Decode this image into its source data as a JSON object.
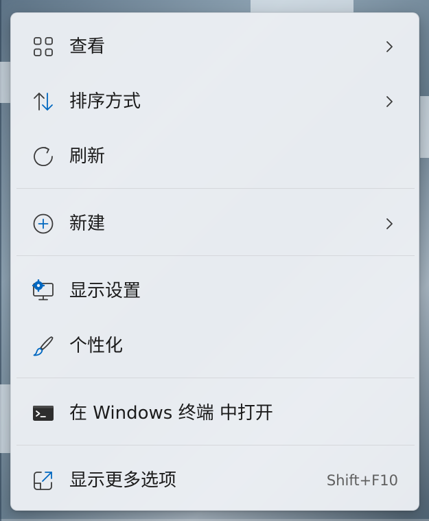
{
  "menu": {
    "items": [
      {
        "label": "查看",
        "icon": "grid-view-icon",
        "submenu": true
      },
      {
        "label": "排序方式",
        "icon": "sort-icon",
        "submenu": true
      },
      {
        "label": "刷新",
        "icon": "refresh-icon",
        "submenu": false
      },
      {
        "label": "新建",
        "icon": "add-circle-icon",
        "submenu": true
      },
      {
        "label": "显示设置",
        "icon": "display-settings-icon",
        "submenu": false
      },
      {
        "label": "个性化",
        "icon": "paintbrush-icon",
        "submenu": false
      },
      {
        "label": "在 Windows 终端 中打开",
        "icon": "terminal-icon",
        "submenu": false
      },
      {
        "label": "显示更多选项",
        "icon": "open-external-icon",
        "submenu": false,
        "shortcut": "Shift+F10"
      }
    ]
  },
  "colors": {
    "accent": "#0067c0",
    "menu_background": "#eceff4",
    "text": "#1b1b1b",
    "shortcut_text": "#5f5f5f"
  }
}
